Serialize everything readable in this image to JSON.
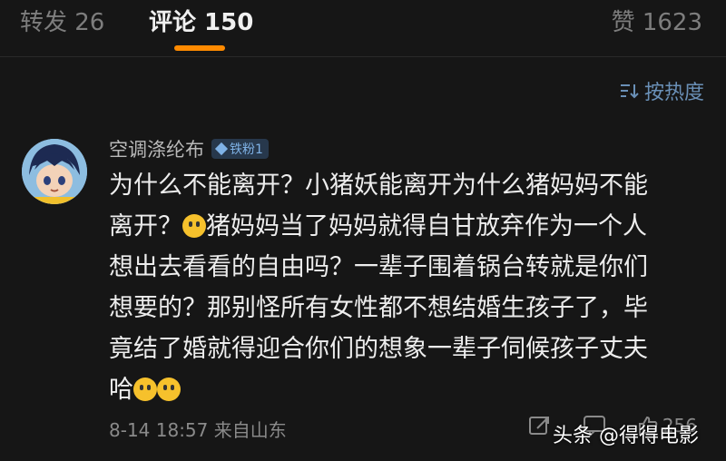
{
  "tabs": {
    "repost": "转发 26",
    "comment": "评论 150",
    "like": "赞 1623"
  },
  "sort": {
    "label": "按热度",
    "icon": "sort-icon"
  },
  "comment": {
    "username": "空调涤纶布",
    "badge": "铁粉1",
    "lines": [
      "为什么不能离开？小猪妖能离开为什么猪妈妈不能",
      "离开？",
      "猪妈妈当了妈妈就得自甘放弃作为一个人",
      "想出去看看的自由吗？一辈子围着锅台转就是你们",
      "想要的？那别怪所有女性都不想结婚生孩子了，毕",
      "竟结了婚就得迎合你们的想象一辈子伺候孩子丈夫",
      "哈"
    ],
    "meta": "8-14 18:57  来自山东",
    "like_count": "256"
  },
  "watermark": "头条 @得得电影",
  "colors": {
    "accent": "#ff8a00",
    "link": "#6a90b7",
    "background": "#161616"
  }
}
